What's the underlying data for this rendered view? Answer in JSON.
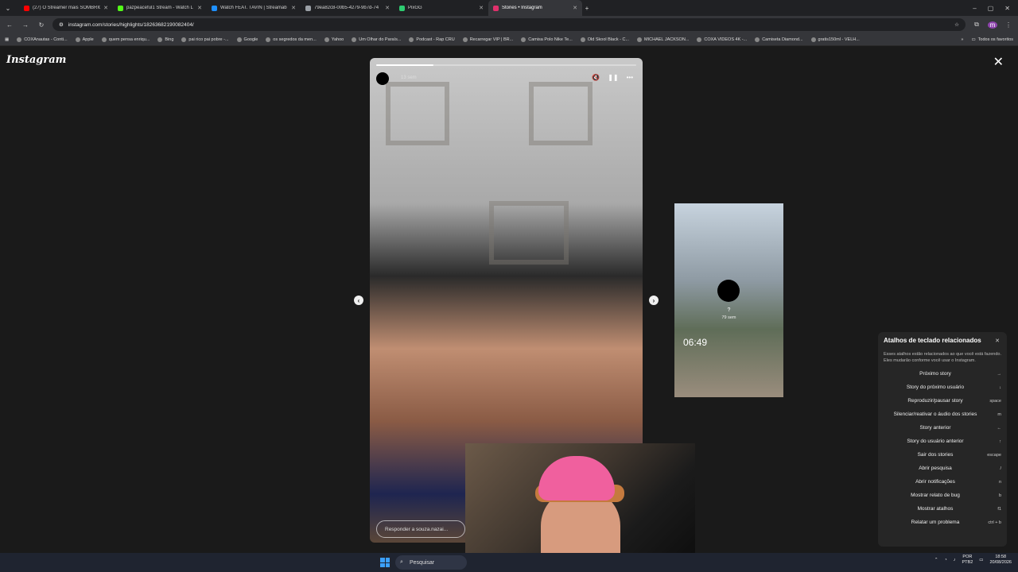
{
  "tabs": [
    {
      "title": "(27) O Streamer mais SOMBRIO",
      "color": "#ff0000"
    },
    {
      "title": "pazpeaceful1 Stream - Watch L",
      "color": "#53fc18"
    },
    {
      "title": "Watch FEAT. TAVIN | Streamab",
      "color": "#1e90ff"
    },
    {
      "title": "79ea82c8-00b5-4279-9b7d-74",
      "color": "#9aa0a6"
    },
    {
      "title": "PixGG",
      "color": "#2ecc71"
    },
    {
      "title": "Stories • Instagram",
      "color": "#e1306c"
    }
  ],
  "address": "instagram.com/stories/highlights/18263682190082404/",
  "bookmarks": [
    "COXAnautas - Conti...",
    "Apple",
    "quem pensa enriqu...",
    "Bing",
    "pai rico pai pobre -...",
    "Google",
    "os segredos da men...",
    "Yahoo",
    "Um Olhar do Paraís...",
    "Podcast - Rap CRU",
    "Recarregar VIP | BR...",
    "Camisa Polo Nike Te...",
    "Old Skool Black - C...",
    "MICHAEL JACKSON...",
    "COXA VÍDEOS 4K -...",
    "Camiseta Diamond...",
    "gratis150ml - VELH..."
  ],
  "bookmarks_all": "Todos os favoritos",
  "app": {
    "logo": "Instagram"
  },
  "story": {
    "time": "13 sem",
    "progress": 0.22,
    "reply_placeholder": "Responder a souza.nazai..."
  },
  "preview": {
    "name": "?",
    "time": "79 sem",
    "clock": "06:49"
  },
  "shortcuts": {
    "title": "Atalhos de teclado relacionados",
    "description": "Esses atalhos estão relacionados ao que você está fazendo. Eles mudarão conforme você usar o Instagram.",
    "items": [
      {
        "label": "Próximo story",
        "key": "→"
      },
      {
        "label": "Story do próximo usuário",
        "key": "↓"
      },
      {
        "label": "Reproduzir/pausar story",
        "key": "space"
      },
      {
        "label": "Silenciar/reativar o áudio dos stories",
        "key": "m"
      },
      {
        "label": "Story anterior",
        "key": "←"
      },
      {
        "label": "Story do usuário anterior",
        "key": "↑"
      },
      {
        "label": "Sair dos stories",
        "key": "escape"
      },
      {
        "label": "Abrir pesquisa",
        "key": "/"
      },
      {
        "label": "Abrir notificações",
        "key": "n"
      },
      {
        "label": "Mostrar relato de bug",
        "key": "b"
      },
      {
        "label": "Mostrar atalhos",
        "key": "f1"
      },
      {
        "label": "Relatar um problema",
        "key": "ctrl + b"
      }
    ]
  },
  "taskbar": {
    "search": "Pesquisar",
    "lang1": "POR",
    "lang2": "PTB2",
    "time": "18:58",
    "date": "20/08/2026"
  }
}
